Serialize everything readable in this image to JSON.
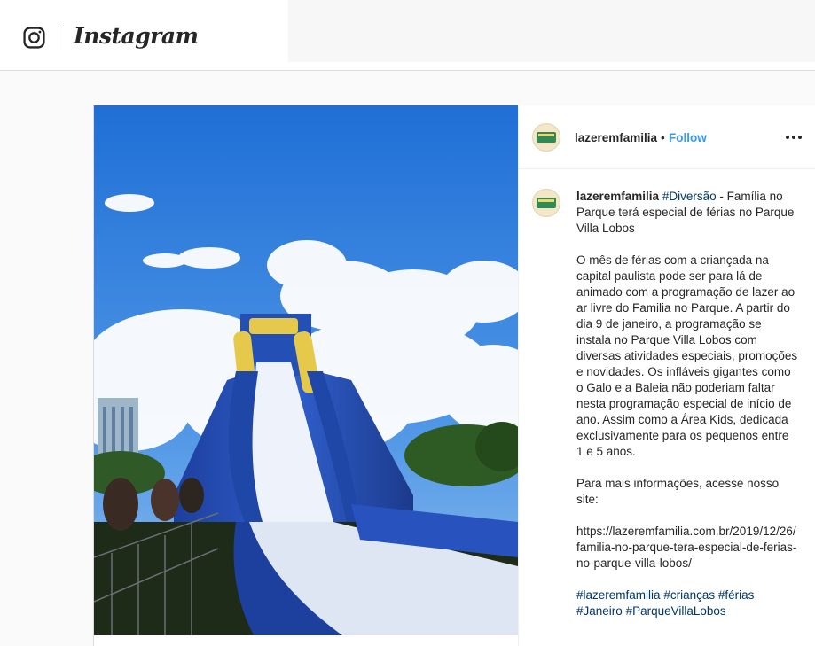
{
  "header": {
    "wordmark": "Instagram",
    "logo_icon": "instagram-camera-icon"
  },
  "post": {
    "username": "lazeremfamilia",
    "separator": "•",
    "follow_label": "Follow",
    "more_icon": "more-options-icon",
    "image_description_icon": "photo",
    "caption": {
      "username": "lazeremfamilia",
      "first_hashtag": "#Diversão",
      "title_rest": " - Família no Parque terá especial de férias no Parque Villa Lobos",
      "body": "O mês de férias com a criançada na capital paulista pode ser para lá de animado com a programação de lazer ao ar livre do Familia no Parque. A partir do dia 9 de janeiro, a programação se instala no Parque Villa Lobos com diversas atividades especiais, promoções e novidades. Os infláveis gigantes como o Galo e a Baleia não poderiam faltar nesta programação especial de início de ano. Assim como a Área Kids, dedicada exclusivamente para os pequenos entre 1 e 5 anos.",
      "more_info": "Para mais informações, acesse nosso site:",
      "link": "https://lazeremfamilia.com.br/2019/12/26/familia-no-parque-tera-especial-de-ferias-no-parque-villa-lobos/",
      "hashtags": [
        "#lazeremfamilia",
        "#crianças",
        "#férias",
        "#Janeiro",
        "#ParqueVillaLobos"
      ]
    }
  },
  "colors": {
    "link_blue": "#3897f0",
    "hashtag": "#00376b",
    "border": "#dbdbdb",
    "background": "#fafafa"
  }
}
